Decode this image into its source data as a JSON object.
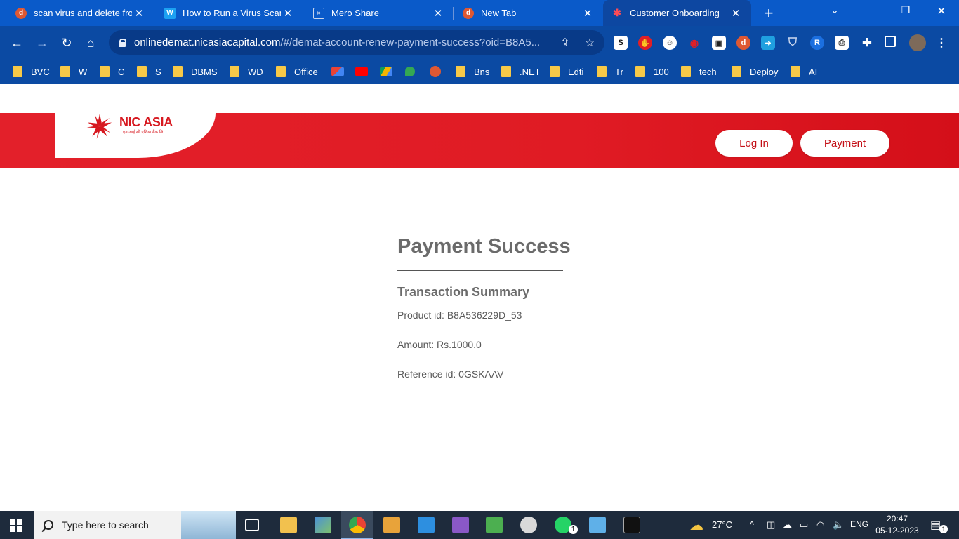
{
  "browser": {
    "tabs": [
      {
        "title": "scan virus and delete fro",
        "favicon": "duckduckgo-icon",
        "active": false
      },
      {
        "title": "How to Run a Virus Scan",
        "favicon": "w-icon",
        "active": false
      },
      {
        "title": "Mero Share",
        "favicon": "meroshare-icon",
        "active": false
      },
      {
        "title": "New Tab",
        "favicon": "duckduckgo-icon",
        "active": false
      },
      {
        "title": "Customer Onboarding",
        "favicon": "nic-asia-icon",
        "active": true
      }
    ],
    "new_tab": "+",
    "address": {
      "host": "onlinedemat.nicasiacapital.com",
      "path": "/#/demat-account-renew-payment-success?oid=B8A5..."
    },
    "bookmarks": [
      "BVC",
      "W",
      "C",
      "S",
      "DBMS",
      "WD",
      "Office",
      "Bns",
      ".NET",
      "Edti",
      "Tr",
      "100",
      "tech",
      "Deploy",
      "AI"
    ],
    "colors": {
      "chrome": "#0b4aa3",
      "tabstrip": "#0a5ac9"
    }
  },
  "header": {
    "logo_text": "NIC ASIA",
    "logo_sub": "एन आई सी एशिया बैंक लि.",
    "login_label": "Log In",
    "payment_label": "Payment",
    "brand_color": "#e3202a"
  },
  "main": {
    "title": "Payment Success",
    "subtitle": "Transaction Summary",
    "product_id": "Product id: B8A536229D_53",
    "amount": "Amount: Rs.1000.0",
    "reference_id": "Reference id: 0GSKAAV"
  },
  "taskbar": {
    "search_placeholder": "Type here to search",
    "weather": "27°C",
    "language": "ENG",
    "time": "20:47",
    "date": "05-12-2023",
    "notification_count": "1",
    "whatsapp_badge": "1"
  }
}
